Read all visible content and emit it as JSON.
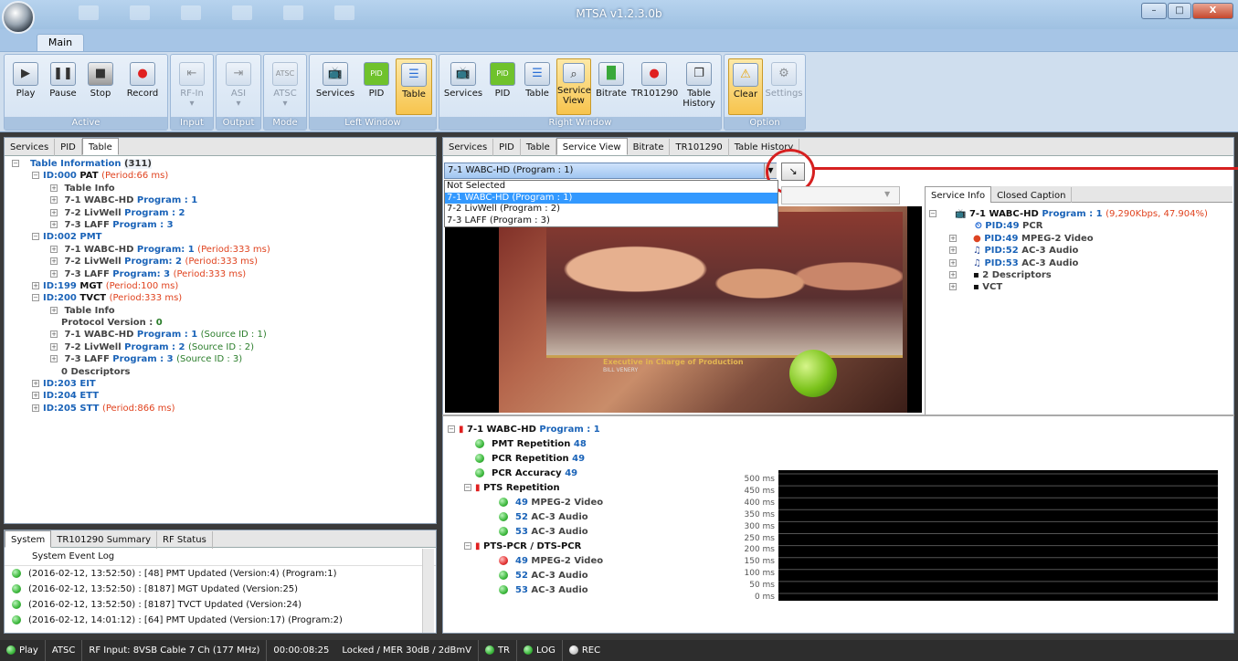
{
  "window": {
    "title": "MTSA v1.2.3.0b",
    "minimize": "–",
    "maximize": "□",
    "close": "X"
  },
  "ribbon": {
    "tab": "Main",
    "groups": [
      {
        "label": "Active",
        "buttons": [
          "Play",
          "Pause",
          "Stop",
          "Record"
        ]
      },
      {
        "label": "Input",
        "buttons": [
          "RF-In"
        ]
      },
      {
        "label": "Output",
        "buttons": [
          "ASI"
        ]
      },
      {
        "label": "Mode",
        "buttons": [
          "ATSC"
        ]
      },
      {
        "label": "Left Window",
        "buttons": [
          "Services",
          "PID",
          "Table"
        ]
      },
      {
        "label": "Right Window",
        "buttons": [
          "Services",
          "PID",
          "Table",
          "Service View",
          "Bitrate",
          "TR101290",
          "Table History"
        ]
      },
      {
        "label": "Option",
        "buttons": [
          "Clear",
          "Settings"
        ]
      }
    ]
  },
  "left_tabs": [
    "Services",
    "PID",
    "Table"
  ],
  "table_tree": {
    "root": "Table Information",
    "root_count": "(311)",
    "pat": "ID:000",
    "pat_name": "PAT",
    "pat_period": "(Period:66 ms)",
    "table_info": "Table Info",
    "pat_services": [
      {
        "name": "7-1 WABC-HD",
        "prog": "Program : 1"
      },
      {
        "name": "7-2 LivWell",
        "prog": "Program : 2"
      },
      {
        "name": "7-3 LAFF",
        "prog": "Program : 3"
      }
    ],
    "pmt": "ID:002 PMT",
    "pmt_services": [
      {
        "name": "7-1 WABC-HD",
        "prog": "Program: 1",
        "period": "(Period:333 ms)"
      },
      {
        "name": "7-2 LivWell",
        "prog": "Program: 2",
        "period": "(Period:333 ms)"
      },
      {
        "name": "7-3 LAFF",
        "prog": "Program: 3",
        "period": "(Period:333 ms)"
      }
    ],
    "mgt": "ID:199",
    "mgt_name": "MGT",
    "mgt_period": "(Period:100 ms)",
    "tvct": "ID:200",
    "tvct_name": "TVCT",
    "tvct_period": "(Period:333 ms)",
    "protocol": "Protocol Version :",
    "protocol_val": "0",
    "tvct_services": [
      {
        "name": "7-1 WABC-HD",
        "prog": "Program : 1",
        "src": "(Source ID : 1)"
      },
      {
        "name": "7-2 LivWell",
        "prog": "Program : 2",
        "src": "(Source ID : 2)"
      },
      {
        "name": "7-3 LAFF",
        "prog": "Program : 3",
        "src": "(Source ID : 3)"
      }
    ],
    "descriptors": "0 Descriptors",
    "eit": "ID:203 EIT",
    "ett": "ID:204 ETT",
    "stt": "ID:205 STT",
    "stt_period": "(Period:866 ms)"
  },
  "system": {
    "tabs": [
      "System",
      "TR101290 Summary",
      "RF Status"
    ],
    "header": "System Event Log",
    "logs": [
      "(2016-02-12, 13:52:50) : [48] PMT Updated (Version:4) (Program:1)",
      "(2016-02-12, 13:52:50) : [8187] MGT Updated (Version:25)",
      "(2016-02-12, 13:52:50) : [8187] TVCT Updated (Version:24)",
      "(2016-02-12, 14:01:12) : [64] PMT Updated (Version:17) (Program:2)"
    ]
  },
  "right_tabs": [
    "Services",
    "PID",
    "Table",
    "Service View",
    "Bitrate",
    "TR101290",
    "Table History"
  ],
  "service_select": {
    "value": "7-1 WABC-HD (Program : 1)",
    "options": [
      "Not Selected",
      "7-1 WABC-HD (Program : 1)",
      "7-2 LivWell (Program : 2)",
      "7-3 LAFF (Program : 3)"
    ]
  },
  "video_overlay": {
    "line1": "Executive in Charge of Production",
    "line2": "BILL VENERY"
  },
  "info_tabs": [
    "Service Info",
    "Closed Caption"
  ],
  "service_info": {
    "name": "7-1 WABC-HD",
    "prog": "Program : 1",
    "rate": "(9,290Kbps, 47.904%)",
    "items": [
      {
        "pid": "PID:49",
        "desc": "PCR"
      },
      {
        "pid": "PID:49",
        "desc": "MPEG-2 Video"
      },
      {
        "pid": "PID:52",
        "desc": "AC-3 Audio"
      },
      {
        "pid": "PID:53",
        "desc": "AC-3 Audio"
      }
    ],
    "descriptors": "2 Descriptors",
    "vct": "VCT"
  },
  "status_tree": {
    "name": "7-1 WABC-HD",
    "prog": "Program : 1",
    "pmt_rep": "PMT Repetition",
    "pmt_rep_val": "48",
    "pcr_rep": "PCR Repetition",
    "pcr_rep_val": "49",
    "pcr_acc": "PCR Accuracy",
    "pcr_acc_val": "49",
    "pts_rep": "PTS Repetition",
    "pts_items": [
      {
        "pid": "49",
        "desc": "MPEG-2 Video"
      },
      {
        "pid": "52",
        "desc": "AC-3 Audio"
      },
      {
        "pid": "53",
        "desc": "AC-3 Audio"
      }
    ],
    "pts_pcr": "PTS-PCR / DTS-PCR",
    "ptspcr_items": [
      {
        "pid": "49",
        "desc": "MPEG-2 Video"
      },
      {
        "pid": "52",
        "desc": "AC-3 Audio"
      },
      {
        "pid": "53",
        "desc": "AC-3 Audio"
      }
    ]
  },
  "chart_data": {
    "type": "line",
    "title": "",
    "y_ticks": [
      "500 ms",
      "450 ms",
      "400 ms",
      "350 ms",
      "300 ms",
      "250 ms",
      "200 ms",
      "150 ms",
      "100 ms",
      "50 ms",
      "0 ms"
    ],
    "ylim": [
      0,
      500
    ],
    "grid": true,
    "series": []
  },
  "statusbar": {
    "play": "Play",
    "mode": "ATSC",
    "rf": "RF Input: 8VSB Cable 7 Ch (177 MHz)",
    "time": "00:00:08:25",
    "lock": "Locked / MER 30dB / 2dBmV",
    "tr": "TR",
    "log": "LOG",
    "rec": "REC"
  },
  "colors": {
    "accent_red": "#e0431f",
    "accent_blue": "#1a63b8",
    "ok_green": "#3cb83c"
  }
}
